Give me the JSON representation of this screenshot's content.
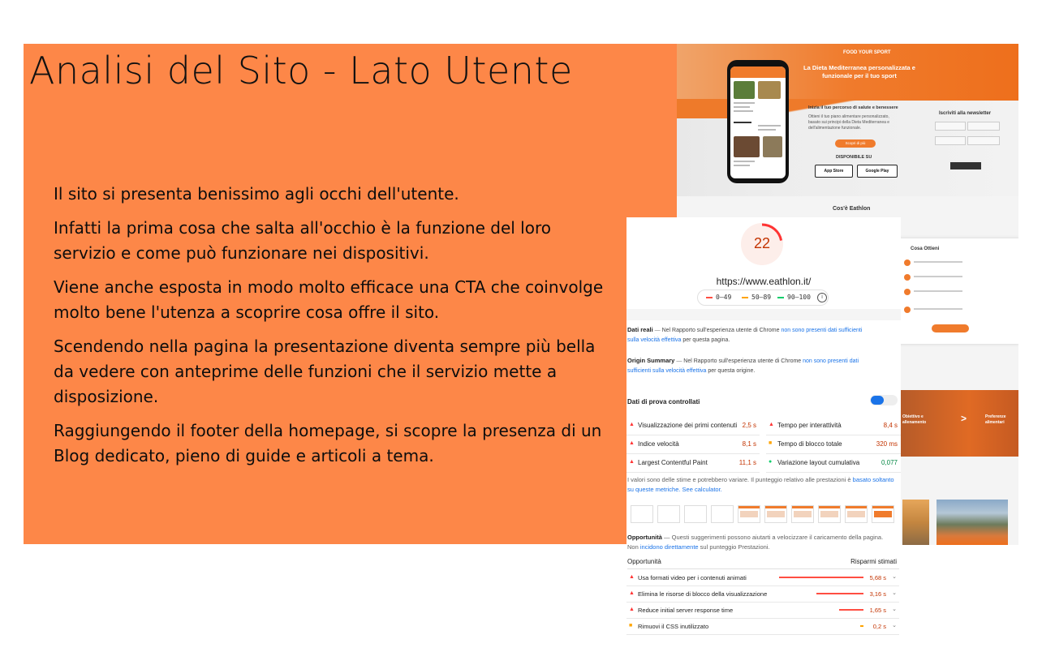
{
  "slide": {
    "title": "Analisi del Sito - Lato Utente",
    "paragraphs": [
      "Il sito si presenta benissimo agli occhi dell'utente.",
      "Infatti la prima cosa che salta all'occhio è la funzione del loro servizio e come può funzionare nei dispositivi.",
      "Viene anche esposta in modo molto efficace una CTA che coinvolge molto bene l'utenza a scoprire cosa offre il sito.",
      "Scendendo nella pagina la presentazione diventa sempre più bella da vedere con anteprime delle funzioni che il servizio mette a disposizione.",
      "Raggiungendo il footer della homepage, si scopre la presenza di un Blog dedicato, pieno di guide e articoli a tema."
    ],
    "background_color": "#fd8748"
  },
  "website": {
    "brand_tag": "FOOD YOUR SPORT",
    "hero_title": "La Dieta Mediterranea personalizzata e funzionale per il tuo sport",
    "hero_subtitle": "Inizia il tuo percorso di salute e benessere",
    "hero_description": "Ottieni il tuo piano alimentare personalizzato, basato sui principi della Dieta Mediterranea e dell'alimentazione funzionale.",
    "cta_label": "Scopri di più",
    "available_on": "DISPONIBILE SU",
    "app_store": "App Store",
    "google_play": "Google Play",
    "newsletter_title": "Iscriviti alla newsletter",
    "section_title": "Cos'è Eathlon",
    "card_title": "Cosa Ottieni",
    "strip_left": "Obiettivo e allenamento",
    "strip_right": "Preferenze alimentari",
    "strip_arrow": ">",
    "accent_color": "#f07b2c"
  },
  "pagespeed": {
    "score": "22",
    "url": "https://www.eathlon.it/",
    "legend": {
      "poor": "0–49",
      "average": "50–89",
      "good": "90–100",
      "info": "i"
    },
    "colors": {
      "poor": "#ff4e42",
      "average": "#ffa400",
      "good": "#0cce6b",
      "link": "#1a73e8"
    },
    "field_data": {
      "title": "Dati reali",
      "text": "Nel Rapporto sull'esperienza utente di Chrome",
      "link": "non sono presenti dati sufficienti sulla velocità effettiva",
      "suffix": "per questa pagina."
    },
    "origin_summary": {
      "title": "Origin Summary",
      "text": "Nel Rapporto sull'esperienza utente di Chrome",
      "link": "non sono presenti dati sufficienti sulla velocità effettiva",
      "suffix": "per questa origine."
    },
    "lab_title": "Dati di prova controllati",
    "metrics": [
      {
        "label": "Visualizzazione dei primi contenuti",
        "value": "2,5 s",
        "status": "poor"
      },
      {
        "label": "Tempo per interattività",
        "value": "8,4 s",
        "status": "poor"
      },
      {
        "label": "Indice velocità",
        "value": "8,1 s",
        "status": "poor"
      },
      {
        "label": "Tempo di blocco totale",
        "value": "320 ms",
        "status": "average"
      },
      {
        "label": "Largest Contentful Paint",
        "value": "11,1 s",
        "status": "poor"
      },
      {
        "label": "Variazione layout cumulativa",
        "value": "0,077",
        "status": "good"
      }
    ],
    "note": {
      "text": "I valori sono delle stime e potrebbero variare. Il punteggio relativo alle prestazioni è",
      "link1": "basato soltanto su queste metriche.",
      "link2": "See calculator."
    },
    "opportunities_header": {
      "title": "Opportunità",
      "text": "Questi suggerimenti possono aiutarti a velocizzare il caricamento della pagina. Non",
      "link": "incidono direttamente",
      "suffix": "sul punteggio Prestazioni."
    },
    "opportunities_col_left": "Opportunità",
    "opportunities_col_right": "Risparmi stimati",
    "opportunities": [
      {
        "label": "Usa formati video per i contenuti animati",
        "value": "5,68 s",
        "status": "poor",
        "savings_seconds": 5.68
      },
      {
        "label": "Elimina le risorse di blocco della visualizzazione",
        "value": "3,16 s",
        "status": "poor",
        "savings_seconds": 3.16
      },
      {
        "label": "Reduce initial server response time",
        "value": "1,65 s",
        "status": "poor",
        "savings_seconds": 1.65
      },
      {
        "label": "Rimuovi il CSS inutilizzato",
        "value": "0,2 s",
        "status": "average",
        "savings_seconds": 0.2
      }
    ]
  }
}
